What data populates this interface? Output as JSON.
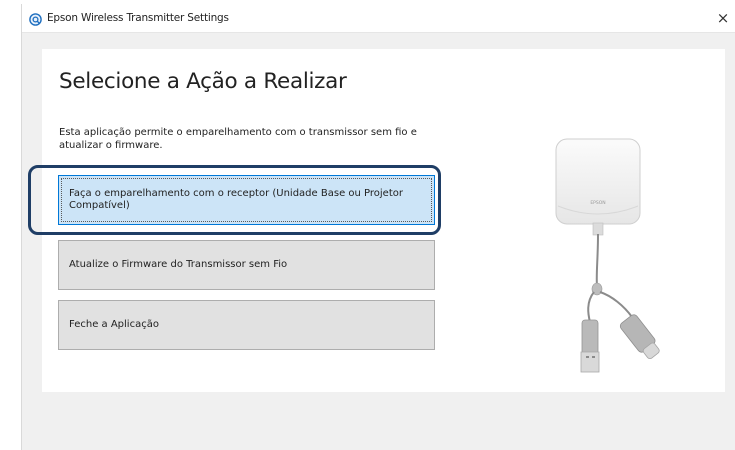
{
  "window": {
    "title": "Epson Wireless Transmitter Settings",
    "app_icon": "epson-settings-icon",
    "close_glyph": "×"
  },
  "main": {
    "heading": "Selecione a Ação a Realizar",
    "description": "Esta aplicação permite o emparelhamento com o transmissor sem fio e atualizar o firmware.",
    "options": [
      {
        "label": "Faça o emparelhamento com o receptor (Unidade Base ou Projetor Compatível)",
        "selected": true
      },
      {
        "label": "Atualize o Firmware do Transmissor sem Fio",
        "selected": false
      },
      {
        "label": "Feche a Aplicação",
        "selected": false
      }
    ]
  },
  "illustration": {
    "device_brand": "EPSON",
    "icon": "wireless-transmitter-device"
  },
  "colors": {
    "selected_bg": "#cce4f7",
    "selected_border": "#0078d7",
    "highlight_ring": "#1f3e66"
  }
}
